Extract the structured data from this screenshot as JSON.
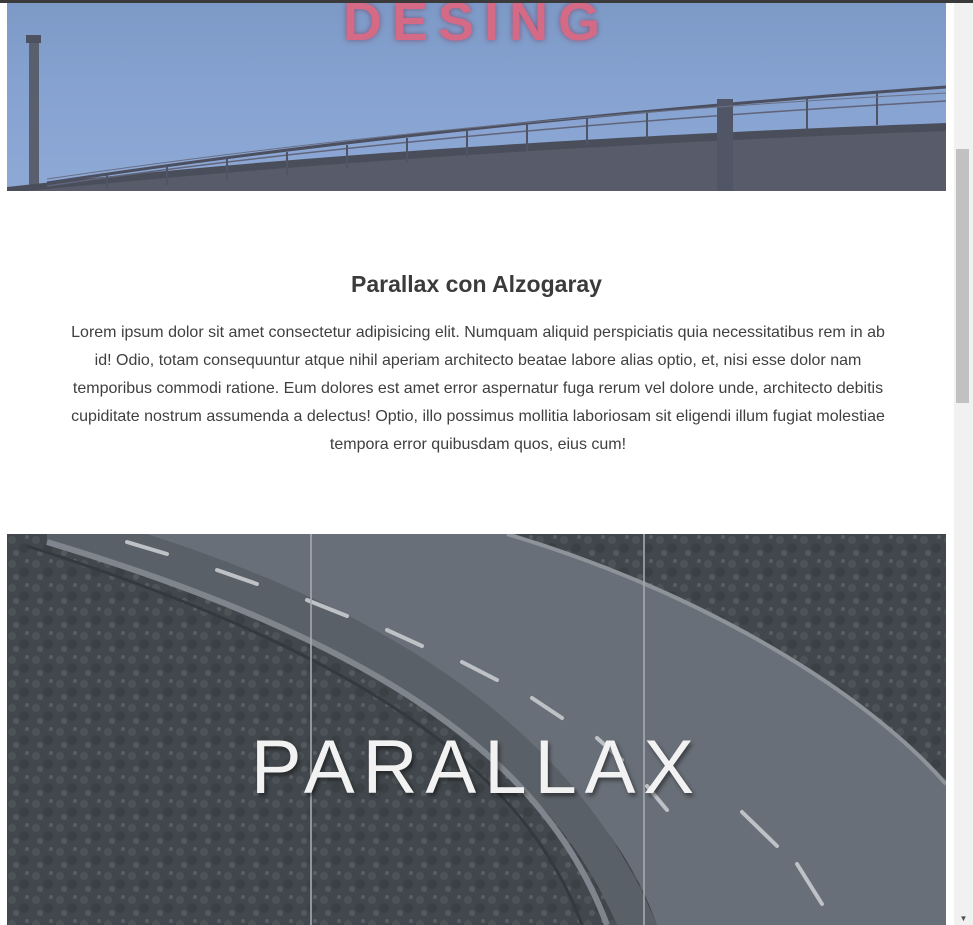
{
  "hero_top": {
    "title": "DESING"
  },
  "section": {
    "title": "Parallax con Alzogaray",
    "body": "Lorem ipsum dolor sit amet consectetur adipisicing elit. Numquam aliquid perspiciatis quia necessitatibus rem in ab id! Odio, totam consequuntur atque nihil aperiam architecto beatae labore alias optio, et, nisi esse dolor nam temporibus commodi ratione. Eum dolores est amet error aspernatur fuga rerum vel dolore unde, architecto debitis cupiditate nostrum assumenda a delectus! Optio, illo possimus mollitia laboriosam sit eligendi illum fugiat molestiae tempora error quibusdam quos, eius cum!"
  },
  "hero_bottom": {
    "title": "PARALLAX"
  },
  "scrollbar": {
    "down_arrow": "▼"
  },
  "colors": {
    "hero_top_title": "#d46a86",
    "sky": "#86a2d0",
    "text": "#3b3b3b",
    "hero_bottom_title": "#f2f2f2"
  }
}
